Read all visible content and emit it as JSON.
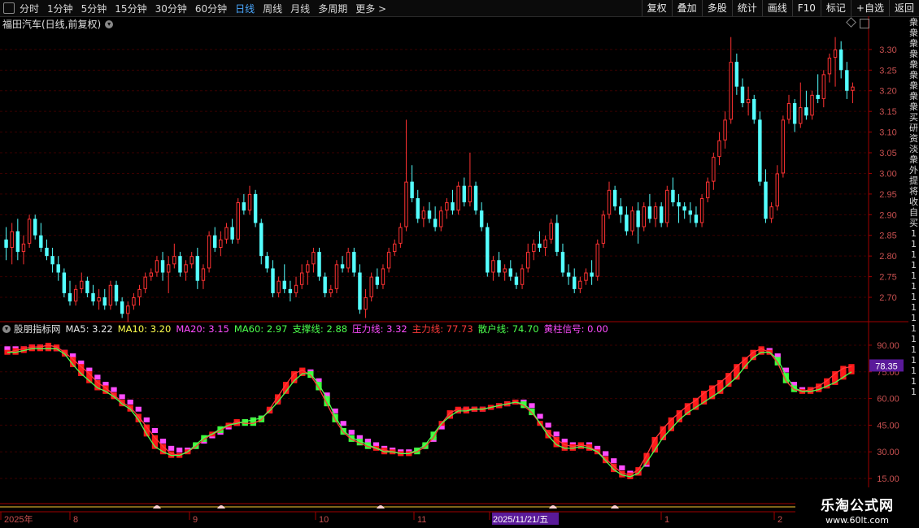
{
  "toolbar": {
    "periods": [
      "分时",
      "1分钟",
      "5分钟",
      "15分钟",
      "30分钟",
      "60分钟",
      "日线",
      "周线",
      "月线",
      "多周期",
      "更多 >"
    ],
    "active_period": "日线",
    "tools": [
      "复权",
      "叠加",
      "多股",
      "统计",
      "画线",
      "F10",
      "标记",
      "+自选",
      "返回"
    ]
  },
  "main_chart": {
    "title": "福田汽车(日线,前复权)",
    "price_ticks": [
      "3.30",
      "3.25",
      "3.20",
      "3.15",
      "3.10",
      "3.05",
      "3.00",
      "2.95",
      "2.90",
      "2.85",
      "2.80",
      "2.75",
      "2.70"
    ],
    "colors": {
      "up": "#ff3232",
      "down": "#54ffff",
      "grid": "#3a0000",
      "axis": "#a00000",
      "ticks": "#c85050"
    }
  },
  "indicator": {
    "name": "股朋指标网",
    "legend": [
      {
        "text": "MA5: 3.22",
        "color": "#e6e6e6"
      },
      {
        "text": "MA10: 3.20",
        "color": "#ffff4c"
      },
      {
        "text": "MA20: 3.15",
        "color": "#ff4cff"
      },
      {
        "text": "MA60: 2.97",
        "color": "#4cff4c"
      },
      {
        "text": "支撑线: 2.88",
        "color": "#4cff4c"
      },
      {
        "text": "压力线: 3.32",
        "color": "#ff4cff"
      },
      {
        "text": "主力线: 77.73",
        "color": "#ff3a3a"
      },
      {
        "text": "散户线: 74.70",
        "color": "#4cff4c"
      },
      {
        "text": "黄柱信号: 0.00",
        "color": "#ff4cff"
      }
    ],
    "ticks": [
      "90.00",
      "75.00",
      "60.00",
      "45.00",
      "30.00",
      "15.00"
    ],
    "current_value": "78.35",
    "current_value_bg": "#5a1a9a"
  },
  "date_axis": {
    "labels": [
      "2025年",
      "8",
      "9",
      "10",
      "11",
      "2025/11/21/五",
      "1",
      "2"
    ],
    "highlight_bg": "#5a1a9a"
  },
  "side_panel": {
    "chars": [
      "衆",
      "衆",
      "衆",
      "衆",
      "衆",
      "衆",
      "衆",
      "衆",
      "衆",
      "买",
      "研",
      "资",
      "淡",
      "衆",
      "外",
      "提",
      "将",
      "收",
      "",
      "",
      "",
      "",
      "",
      "",
      "",
      "",
      "",
      "自",
      "买",
      "1",
      "1",
      "1",
      "1",
      "1",
      "1",
      "1",
      "1",
      "1",
      "1",
      "1",
      "1",
      "1",
      "1",
      "1",
      "1"
    ]
  },
  "watermark": {
    "line1": "乐淘公式网",
    "line2": "www.60lt.com"
  },
  "chart_data": {
    "type": "candlestick",
    "candles_ohlc": [
      [
        2.84,
        2.87,
        2.79,
        2.82
      ],
      [
        2.82,
        2.88,
        2.78,
        2.86
      ],
      [
        2.86,
        2.89,
        2.79,
        2.81
      ],
      [
        2.81,
        2.85,
        2.78,
        2.83
      ],
      [
        2.83,
        2.9,
        2.82,
        2.89
      ],
      [
        2.89,
        2.9,
        2.84,
        2.85
      ],
      [
        2.85,
        2.88,
        2.81,
        2.82
      ],
      [
        2.82,
        2.84,
        2.79,
        2.8
      ],
      [
        2.8,
        2.82,
        2.76,
        2.78
      ],
      [
        2.78,
        2.8,
        2.74,
        2.76
      ],
      [
        2.76,
        2.77,
        2.7,
        2.71
      ],
      [
        2.71,
        2.74,
        2.68,
        2.69
      ],
      [
        2.69,
        2.73,
        2.68,
        2.72
      ],
      [
        2.72,
        2.76,
        2.71,
        2.74
      ],
      [
        2.74,
        2.75,
        2.7,
        2.71
      ],
      [
        2.71,
        2.73,
        2.68,
        2.69
      ],
      [
        2.69,
        2.72,
        2.67,
        2.7
      ],
      [
        2.7,
        2.72,
        2.67,
        2.68
      ],
      [
        2.68,
        2.74,
        2.67,
        2.73
      ],
      [
        2.73,
        2.74,
        2.68,
        2.69
      ],
      [
        2.69,
        2.7,
        2.65,
        2.66
      ],
      [
        2.66,
        2.69,
        2.64,
        2.68
      ],
      [
        2.68,
        2.71,
        2.67,
        2.7
      ],
      [
        2.7,
        2.73,
        2.68,
        2.72
      ],
      [
        2.72,
        2.76,
        2.71,
        2.75
      ],
      [
        2.75,
        2.77,
        2.74,
        2.76
      ],
      [
        2.76,
        2.8,
        2.75,
        2.79
      ],
      [
        2.79,
        2.81,
        2.74,
        2.76
      ],
      [
        2.76,
        2.8,
        2.71,
        2.78
      ],
      [
        2.78,
        2.83,
        2.77,
        2.8
      ],
      [
        2.8,
        2.81,
        2.75,
        2.76
      ],
      [
        2.76,
        2.79,
        2.74,
        2.78
      ],
      [
        2.78,
        2.81,
        2.77,
        2.8
      ],
      [
        2.8,
        2.82,
        2.72,
        2.74
      ],
      [
        2.74,
        2.78,
        2.72,
        2.77
      ],
      [
        2.77,
        2.86,
        2.76,
        2.85
      ],
      [
        2.85,
        2.87,
        2.81,
        2.82
      ],
      [
        2.82,
        2.86,
        2.8,
        2.84
      ],
      [
        2.84,
        2.88,
        2.83,
        2.87
      ],
      [
        2.87,
        2.89,
        2.83,
        2.84
      ],
      [
        2.84,
        2.94,
        2.83,
        2.93
      ],
      [
        2.93,
        2.95,
        2.9,
        2.91
      ],
      [
        2.91,
        2.97,
        2.9,
        2.95
      ],
      [
        2.95,
        2.96,
        2.87,
        2.88
      ],
      [
        2.88,
        2.89,
        2.78,
        2.8
      ],
      [
        2.8,
        2.81,
        2.76,
        2.77
      ],
      [
        2.77,
        2.79,
        2.7,
        2.71
      ],
      [
        2.71,
        2.75,
        2.7,
        2.74
      ],
      [
        2.74,
        2.78,
        2.71,
        2.72
      ],
      [
        2.72,
        2.74,
        2.69,
        2.71
      ],
      [
        2.71,
        2.75,
        2.7,
        2.73
      ],
      [
        2.73,
        2.78,
        2.72,
        2.76
      ],
      [
        2.76,
        2.79,
        2.73,
        2.78
      ],
      [
        2.78,
        2.82,
        2.76,
        2.81
      ],
      [
        2.81,
        2.82,
        2.74,
        2.75
      ],
      [
        2.75,
        2.76,
        2.7,
        2.71
      ],
      [
        2.71,
        2.73,
        2.7,
        2.72
      ],
      [
        2.72,
        2.79,
        2.71,
        2.78
      ],
      [
        2.78,
        2.8,
        2.76,
        2.77
      ],
      [
        2.77,
        2.82,
        2.76,
        2.81
      ],
      [
        2.81,
        2.82,
        2.75,
        2.76
      ],
      [
        2.76,
        2.78,
        2.66,
        2.67
      ],
      [
        2.67,
        2.72,
        2.65,
        2.7
      ],
      [
        2.7,
        2.76,
        2.69,
        2.75
      ],
      [
        2.75,
        2.77,
        2.72,
        2.73
      ],
      [
        2.73,
        2.78,
        2.72,
        2.77
      ],
      [
        2.77,
        2.82,
        2.76,
        2.81
      ],
      [
        2.81,
        2.84,
        2.8,
        2.83
      ],
      [
        2.83,
        2.88,
        2.82,
        2.87
      ],
      [
        2.87,
        3.13,
        2.86,
        2.98
      ],
      [
        2.98,
        3.02,
        2.93,
        2.94
      ],
      [
        2.94,
        2.96,
        2.88,
        2.89
      ],
      [
        2.89,
        2.92,
        2.87,
        2.91
      ],
      [
        2.91,
        2.93,
        2.88,
        2.89
      ],
      [
        2.89,
        2.92,
        2.86,
        2.87
      ],
      [
        2.87,
        2.92,
        2.86,
        2.91
      ],
      [
        2.91,
        2.94,
        2.89,
        2.93
      ],
      [
        2.93,
        2.96,
        2.9,
        2.91
      ],
      [
        2.91,
        2.98,
        2.9,
        2.97
      ],
      [
        2.97,
        2.99,
        2.92,
        2.93
      ],
      [
        2.93,
        3.05,
        2.92,
        2.97
      ],
      [
        2.97,
        2.98,
        2.9,
        2.91
      ],
      [
        2.91,
        2.93,
        2.86,
        2.87
      ],
      [
        2.87,
        2.88,
        2.75,
        2.76
      ],
      [
        2.76,
        2.8,
        2.74,
        2.79
      ],
      [
        2.79,
        2.81,
        2.75,
        2.76
      ],
      [
        2.76,
        2.78,
        2.74,
        2.77
      ],
      [
        2.77,
        2.79,
        2.74,
        2.75
      ],
      [
        2.75,
        2.76,
        2.72,
        2.73
      ],
      [
        2.73,
        2.78,
        2.72,
        2.77
      ],
      [
        2.77,
        2.83,
        2.76,
        2.81
      ],
      [
        2.81,
        2.84,
        2.79,
        2.83
      ],
      [
        2.83,
        2.86,
        2.81,
        2.82
      ],
      [
        2.82,
        2.85,
        2.8,
        2.84
      ],
      [
        2.84,
        2.89,
        2.83,
        2.88
      ],
      [
        2.88,
        2.9,
        2.8,
        2.81
      ],
      [
        2.81,
        2.83,
        2.75,
        2.76
      ],
      [
        2.76,
        2.78,
        2.73,
        2.75
      ],
      [
        2.75,
        2.77,
        2.71,
        2.72
      ],
      [
        2.72,
        2.75,
        2.71,
        2.74
      ],
      [
        2.74,
        2.77,
        2.73,
        2.76
      ],
      [
        2.76,
        2.79,
        2.73,
        2.75
      ],
      [
        2.75,
        2.84,
        2.74,
        2.83
      ],
      [
        2.83,
        2.91,
        2.82,
        2.9
      ],
      [
        2.9,
        2.98,
        2.89,
        2.96
      ],
      [
        2.96,
        2.97,
        2.91,
        2.92
      ],
      [
        2.92,
        2.94,
        2.88,
        2.9
      ],
      [
        2.9,
        2.92,
        2.85,
        2.86
      ],
      [
        2.86,
        2.92,
        2.85,
        2.91
      ],
      [
        2.91,
        2.93,
        2.83,
        2.87
      ],
      [
        2.87,
        2.93,
        2.86,
        2.92
      ],
      [
        2.92,
        2.95,
        2.88,
        2.89
      ],
      [
        2.89,
        2.93,
        2.87,
        2.92
      ],
      [
        2.92,
        2.93,
        2.87,
        2.88
      ],
      [
        2.88,
        2.97,
        2.87,
        2.96
      ],
      [
        2.96,
        2.99,
        2.92,
        2.93
      ],
      [
        2.93,
        2.95,
        2.88,
        2.92
      ],
      [
        2.92,
        2.93,
        2.89,
        2.91
      ],
      [
        2.91,
        2.93,
        2.88,
        2.9
      ],
      [
        2.9,
        2.92,
        2.87,
        2.88
      ],
      [
        2.88,
        2.95,
        2.87,
        2.94
      ],
      [
        2.94,
        2.99,
        2.93,
        2.98
      ],
      [
        2.98,
        3.05,
        2.96,
        3.04
      ],
      [
        3.04,
        3.1,
        3.02,
        3.08
      ],
      [
        3.08,
        3.15,
        3.06,
        3.13
      ],
      [
        3.13,
        3.33,
        3.12,
        3.27
      ],
      [
        3.27,
        3.29,
        3.19,
        3.21
      ],
      [
        3.21,
        3.23,
        3.16,
        3.17
      ],
      [
        3.17,
        3.21,
        3.14,
        3.18
      ],
      [
        3.18,
        3.19,
        3.12,
        3.13
      ],
      [
        3.13,
        3.15,
        2.97,
        2.98
      ],
      [
        2.98,
        3.01,
        2.88,
        2.89
      ],
      [
        2.89,
        2.93,
        2.88,
        2.92
      ],
      [
        2.92,
        3.02,
        2.91,
        3.0
      ],
      [
        3.0,
        3.14,
        2.99,
        3.13
      ],
      [
        3.13,
        3.19,
        3.12,
        3.17
      ],
      [
        3.17,
        3.18,
        3.1,
        3.12
      ],
      [
        3.12,
        3.22,
        3.11,
        3.16
      ],
      [
        3.16,
        3.2,
        3.13,
        3.14
      ],
      [
        3.14,
        3.2,
        3.13,
        3.19
      ],
      [
        3.19,
        3.24,
        3.17,
        3.18
      ],
      [
        3.18,
        3.25,
        3.16,
        3.24
      ],
      [
        3.24,
        3.29,
        3.22,
        3.28
      ],
      [
        3.28,
        3.33,
        3.21,
        3.3
      ],
      [
        3.3,
        3.32,
        3.23,
        3.25
      ],
      [
        3.25,
        3.27,
        3.18,
        3.2
      ],
      [
        3.2,
        3.22,
        3.17,
        3.21
      ]
    ],
    "main_line_values": [
      86,
      87,
      88,
      89,
      89,
      90,
      89,
      86,
      82,
      78,
      74,
      69,
      66,
      62,
      58,
      55,
      50,
      44,
      38,
      33,
      29,
      28,
      30,
      33,
      37,
      40,
      42,
      45,
      47,
      46,
      46,
      48,
      54,
      61,
      68,
      74,
      76,
      73,
      66,
      57,
      48,
      41,
      37,
      35,
      33,
      32,
      31,
      30,
      29,
      29,
      30,
      33,
      38,
      46,
      52,
      54,
      54,
      54,
      54,
      55,
      56,
      57,
      58,
      56,
      52,
      46,
      41,
      37,
      34,
      33,
      34,
      33,
      30,
      26,
      22,
      18,
      17,
      20,
      28,
      37,
      43,
      48,
      52,
      56,
      59,
      63,
      66,
      69,
      73,
      78,
      82,
      86,
      88,
      86,
      80,
      70,
      65,
      64,
      65,
      67,
      70,
      74,
      77,
      78
    ],
    "retail_line_values": [
      86,
      86,
      87,
      88,
      88,
      88,
      88,
      85,
      79,
      74,
      70,
      66,
      64,
      61,
      57,
      54,
      48,
      40,
      33,
      30,
      28,
      28,
      30,
      34,
      38,
      40,
      43,
      45,
      46,
      47,
      48,
      49,
      53,
      58,
      64,
      70,
      74,
      74,
      68,
      60,
      50,
      42,
      38,
      36,
      34,
      32,
      30,
      30,
      29,
      29,
      31,
      34,
      40,
      46,
      50,
      53,
      53,
      54,
      54,
      55,
      56,
      57,
      58,
      57,
      53,
      46,
      39,
      34,
      32,
      32,
      33,
      32,
      30,
      25,
      20,
      17,
      16,
      18,
      24,
      31,
      38,
      43,
      48,
      52,
      55,
      58,
      61,
      64,
      68,
      72,
      78,
      83,
      86,
      86,
      82,
      73,
      66,
      64,
      64,
      65,
      67,
      69,
      72,
      75
    ],
    "pressure_line_values": [
      88,
      88,
      88,
      89,
      89,
      89,
      88,
      86,
      84,
      80,
      76,
      72,
      68,
      65,
      61,
      58,
      54,
      48,
      42,
      36,
      32,
      31,
      31,
      33,
      36,
      39,
      41,
      44,
      46,
      47,
      48,
      49,
      53,
      59,
      65,
      71,
      75,
      75,
      70,
      62,
      53,
      46,
      41,
      38,
      36,
      34,
      32,
      31,
      30,
      30,
      31,
      33,
      37,
      44,
      50,
      53,
      54,
      54,
      54,
      55,
      56,
      57,
      58,
      58,
      56,
      50,
      45,
      40,
      36,
      34,
      34,
      34,
      32,
      29,
      25,
      21,
      18,
      18,
      23,
      31,
      38,
      44,
      49,
      53,
      56,
      60,
      63,
      66,
      70,
      74,
      79,
      84,
      87,
      87,
      84,
      76,
      68,
      65,
      65,
      66,
      68,
      71,
      74,
      77
    ]
  }
}
